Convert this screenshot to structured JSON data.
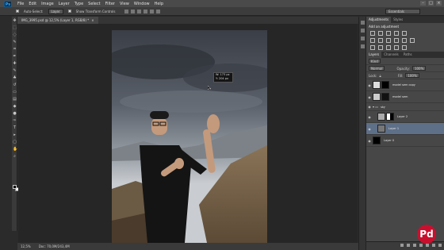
{
  "app": {
    "logo": "Ps"
  },
  "menu": [
    "File",
    "Edit",
    "Image",
    "Layer",
    "Type",
    "Select",
    "Filter",
    "View",
    "Window",
    "Help"
  ],
  "window_controls": {
    "minimize": "–",
    "maximize": "□",
    "close": "×"
  },
  "options_bar": {
    "auto_select_label": "Auto-Select:",
    "auto_select_value": "Layer",
    "show_transform_label": "Show Transform Controls",
    "workspace": "Essentials"
  },
  "document_tab": {
    "title": "IMG_3995.psd @ 12,5% (Layer 1, RGB/8) *",
    "close": "×"
  },
  "status_bar": {
    "zoom": "12,5%",
    "doc": "Doc: 70,0M/243,4M"
  },
  "transform_info": {
    "line1": "W: 173 px",
    "line2": "Y: 204 px"
  },
  "adjustments": {
    "tabs": [
      "Adjustments",
      "Styles"
    ],
    "title": "Add an adjustment"
  },
  "layers_panel": {
    "tabs": [
      "Layers",
      "Channels",
      "Paths"
    ],
    "kind_label": "Kind",
    "blend_mode": "Normal",
    "opacity_label": "Opacity:",
    "opacity_value": "100%",
    "lock_label": "Lock:",
    "fill_label": "Fill:",
    "fill_value": "100%",
    "layers": [
      {
        "name": "model sem copy",
        "visible": true,
        "selected": false
      },
      {
        "name": "model sem",
        "visible": true,
        "selected": false
      },
      {
        "name": "sky",
        "visible": true,
        "selected": false,
        "group": true
      },
      {
        "name": "Layer 2",
        "visible": true,
        "selected": false
      },
      {
        "name": "Layer 1",
        "visible": true,
        "selected": true
      },
      {
        "name": "Layer 0",
        "visible": true,
        "selected": false
      }
    ]
  },
  "watermark": {
    "text": "Pd"
  },
  "colors": {
    "selection": "#5e6f88",
    "brand": "#c8102e",
    "ps_blue": "#31a8ff"
  }
}
